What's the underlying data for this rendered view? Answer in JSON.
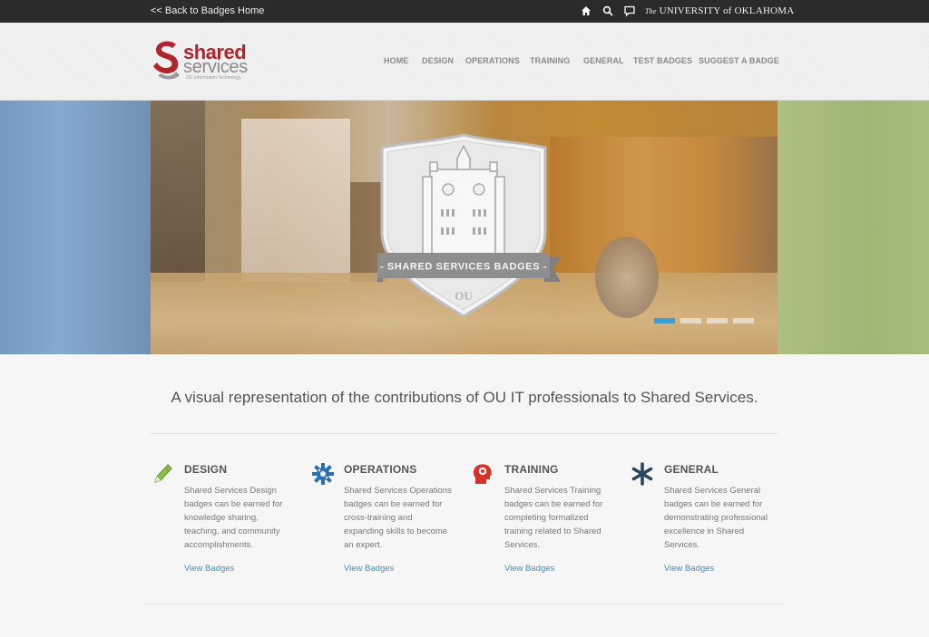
{
  "topbar": {
    "back_link": "<< Back to Badges Home",
    "home_icon": "home-icon",
    "search_icon": "search-icon",
    "chat_icon": "chat-icon",
    "university_prefix": "The",
    "university_name": "UNIVERSITY of OKLAHOMA"
  },
  "logo": {
    "line1": "shared",
    "line2": "services",
    "tagline": "OU Information Technology"
  },
  "nav": {
    "items": [
      "HOME",
      "DESIGN",
      "OPERATIONS",
      "TRAINING",
      "GENERAL",
      "TEST BADGES",
      "SUGGEST A BADGE"
    ]
  },
  "hero": {
    "badge_label": "- SHARED SERVICES BADGES -",
    "slides": 4,
    "active_slide": 1
  },
  "tagline": "A visual representation of the contributions of OU IT professionals to Shared Services.",
  "categories": [
    {
      "title": "DESIGN",
      "icon": "pencil-icon",
      "description": "Shared Services Design badges can be earned for knowledge sharing, teaching, and community accomplishments.",
      "link": "View Badges"
    },
    {
      "title": "OPERATIONS",
      "icon": "gear-icon",
      "description": "Shared Services Operations badges can be earned for cross-training and expanding skills to become an expert.",
      "link": "View Badges"
    },
    {
      "title": "TRAINING",
      "icon": "brain-head-icon",
      "description": "Shared Services Training badges can be earned for completing formalized training related to Shared Services.",
      "link": "View Badges"
    },
    {
      "title": "GENERAL",
      "icon": "star-icon",
      "description": "Shared Services General badges can be earned for demonstrating professional excellence in Shared Services.",
      "link": "View Badges"
    }
  ],
  "colors": {
    "brand_red": "#b0242b",
    "link_blue": "#3a8fc4",
    "active_dot": "#3ba0d3",
    "design_green": "#7ab83a",
    "operations_blue": "#2b6cb3",
    "training_red": "#d6312b",
    "general_navy": "#2a4560"
  }
}
